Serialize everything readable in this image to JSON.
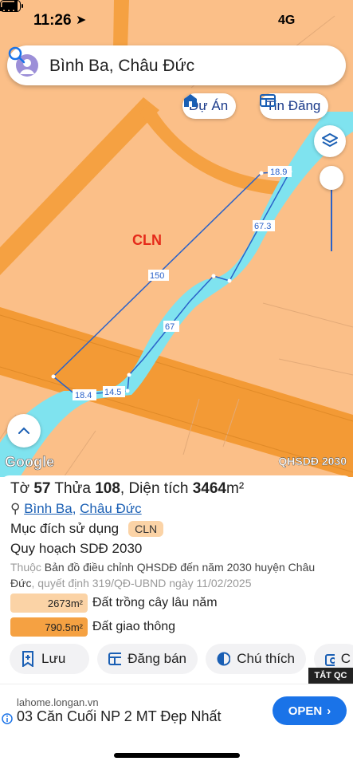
{
  "status": {
    "time": "11:26",
    "network": "4G"
  },
  "search": {
    "text": "Bình Ba, Châu Đức"
  },
  "chips": {
    "projects": "Dự Án",
    "listings": "Tin Đăng"
  },
  "map": {
    "zone_label": "CLN",
    "edges": [
      "18.9",
      "67.3",
      "150",
      "67",
      "18.4",
      "14.5"
    ],
    "source_label": "QHSDĐ 2030",
    "logo": "Google"
  },
  "parcel": {
    "sheet_prefix": "Tờ ",
    "sheet_no": "57",
    "plot_prefix": " Thửa ",
    "plot_no": "108",
    "area_prefix": ", Diện tích ",
    "area_value": "3464",
    "area_unit": "m²",
    "commune": "Bình Ba",
    "district": "Châu Đức",
    "purpose_label": "Mục đích sử dụng",
    "purpose_code": "CLN",
    "plan_label": "Quy hoạch SDĐ 2030",
    "source_prefix": "Thuộc",
    "source_text": " Bản đồ điều chỉnh QHSDĐ đến năm 2030 huyện Châu Đức",
    "decision_text": ", quyết định 319/QĐ-UBND ngày 11/02/2025",
    "legend": [
      {
        "area": "2673m²",
        "label": "Đất trồng cây lâu năm",
        "color": "#fbd3a6"
      },
      {
        "area": "790.5m²",
        "label": "Đất giao thông",
        "color": "#f5a142"
      }
    ]
  },
  "actions": {
    "save": "Lưu",
    "post": "Đăng bán",
    "legend": "Chú thích",
    "more": "C"
  },
  "ad": {
    "close": "TẮT QC",
    "domain": "lahome.longan.vn",
    "title": "03 Căn Cuối NP 2 MT Đẹp Nhất",
    "cta": "OPEN"
  }
}
